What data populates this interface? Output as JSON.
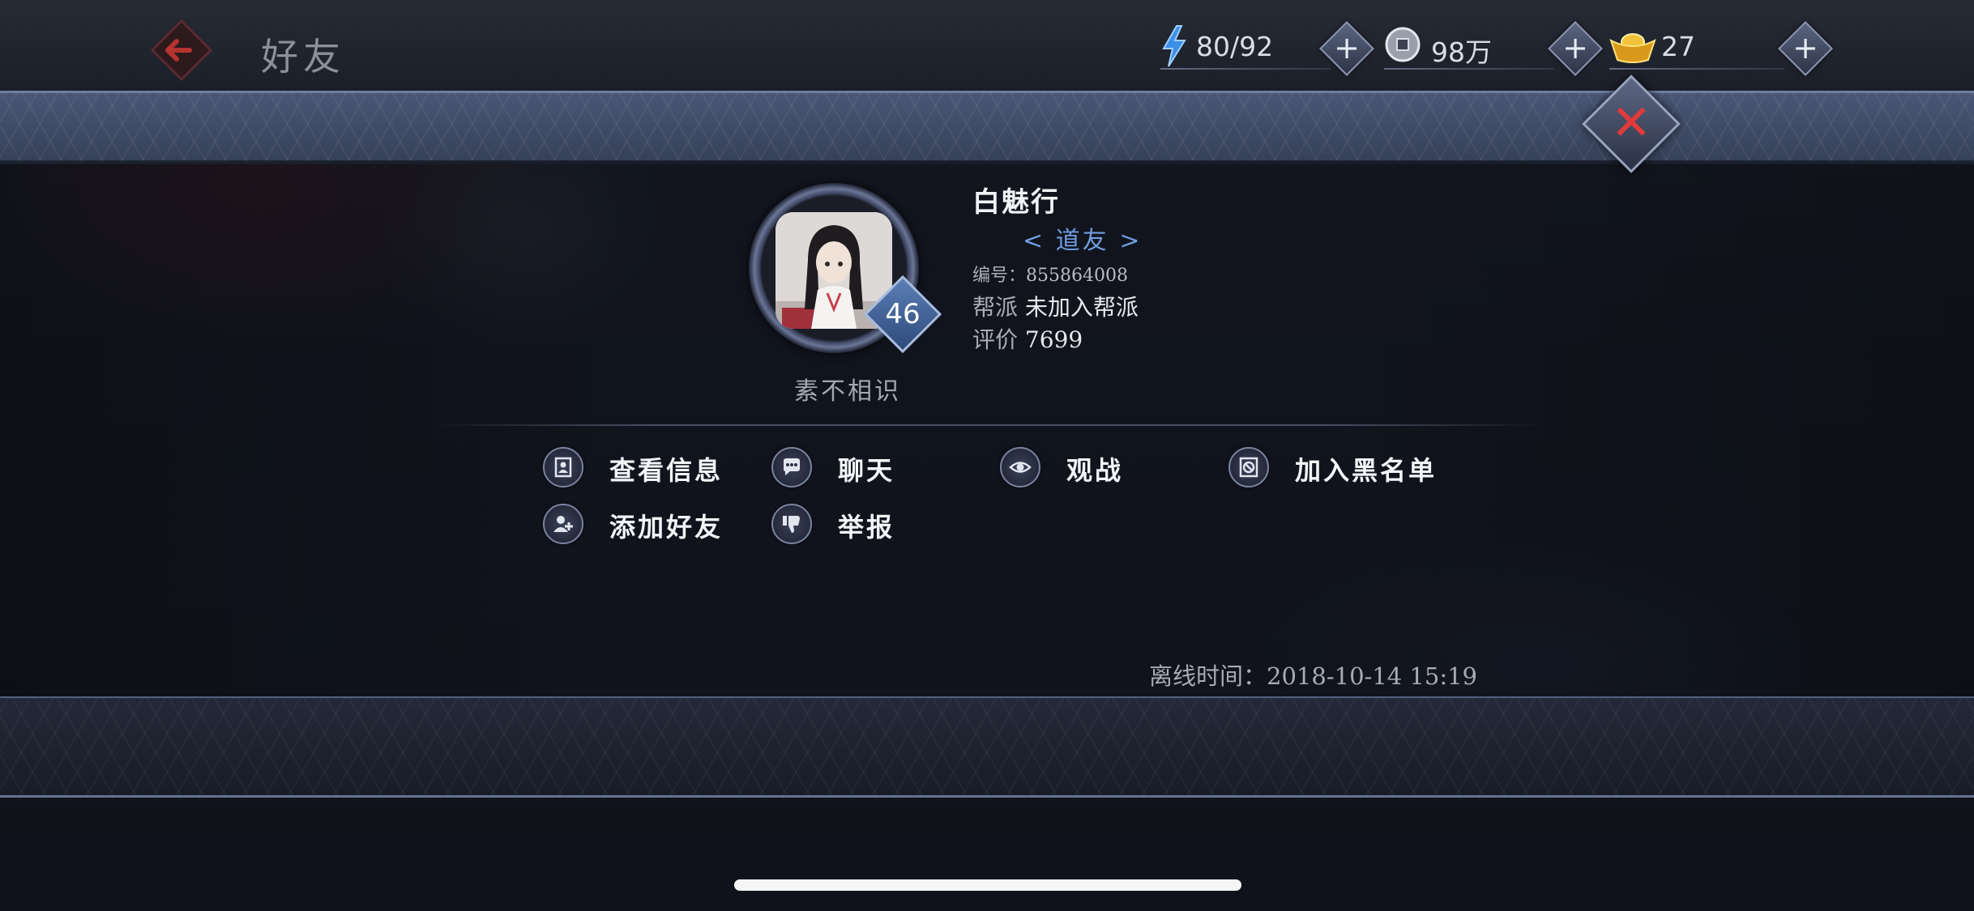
{
  "header": {
    "title": "好友",
    "back_icon": "back-arrow-icon"
  },
  "resources": {
    "stamina": {
      "icon": "lightning-icon",
      "value": "80/92"
    },
    "coins": {
      "icon": "coin-icon",
      "value": "98万"
    },
    "ingots": {
      "icon": "gold-ingot-icon",
      "value": "27"
    },
    "plus_symbol": "+"
  },
  "close": {
    "icon": "close-icon",
    "symbol": "✕"
  },
  "profile": {
    "level": "46",
    "relation": "素不相识",
    "name": "白魅行",
    "title": "< 道友 >",
    "id_label": "编号：",
    "id_value": "855864008",
    "guild_label": "帮派",
    "guild_value": "未加入帮派",
    "rating_label": "评价",
    "rating_value": "7699"
  },
  "actions": [
    {
      "label": "查看信息",
      "icon": "profile-card-icon"
    },
    {
      "label": "聊天",
      "icon": "chat-bubble-icon"
    },
    {
      "label": "观战",
      "icon": "eye-icon"
    },
    {
      "label": "加入黑名单",
      "icon": "block-icon"
    },
    {
      "label": "添加好友",
      "icon": "add-friend-icon"
    },
    {
      "label": "举报",
      "icon": "thumbs-down-icon"
    }
  ],
  "offline": {
    "label": "离线时间：",
    "time": "2018-10-14 15:19"
  },
  "colors": {
    "accent_blue": "#6f9de0",
    "close_red": "#e23a3a",
    "badge_blue": "#3d5f99"
  }
}
